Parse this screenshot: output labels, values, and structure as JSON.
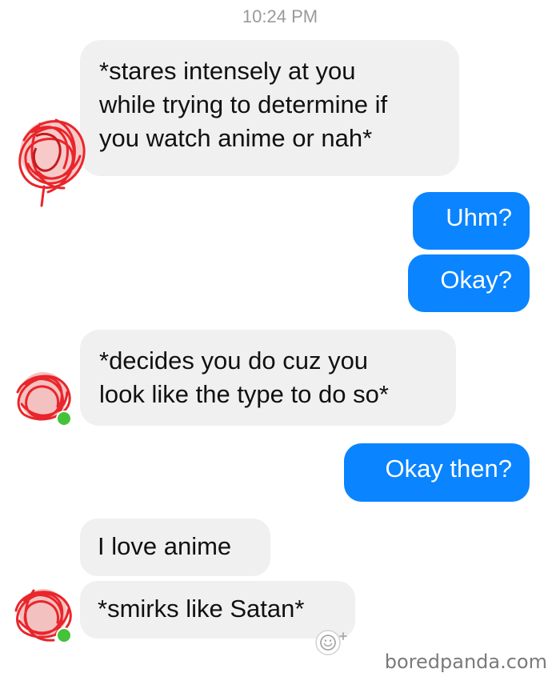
{
  "conversation": {
    "timestamp": "10:24 PM",
    "messages": [
      {
        "side": "incoming",
        "text": "*stares intensely at you\nwhile trying to determine if\nyou watch anime or nah*"
      },
      {
        "side": "outgoing",
        "text": "Uhm?"
      },
      {
        "side": "outgoing",
        "text": "Okay?"
      },
      {
        "side": "incoming",
        "text": "*decides you do cuz you\nlook like the type to do so*"
      },
      {
        "side": "outgoing",
        "text": "Okay then?"
      },
      {
        "side": "incoming",
        "text": "I love anime"
      },
      {
        "side": "incoming",
        "text": "*smirks like Satan*"
      }
    ]
  },
  "colors": {
    "incoming_bubble": "#f0f0f0",
    "outgoing_bubble": "#0a84ff",
    "online_dot": "#44c23a",
    "scribble": "#e8262b"
  },
  "icons": {
    "avatar": "redacted-avatar-scribble",
    "reaction": "add-reaction-smiley-icon"
  },
  "watermark": "boredpanda.com"
}
